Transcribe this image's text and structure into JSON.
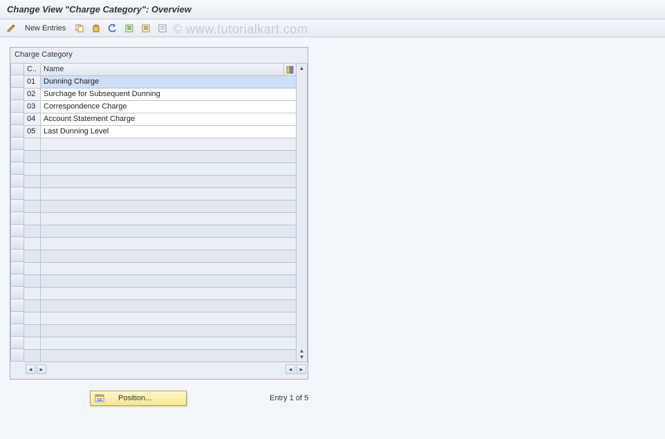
{
  "title": "Change View \"Charge Category\": Overview",
  "watermark": "© www.tutorialkart.com",
  "toolbar": {
    "new_entries_label": "New Entries"
  },
  "panel": {
    "title": "Charge Category",
    "columns": {
      "code": "C..",
      "name": "Name"
    },
    "rows": [
      {
        "code": "01",
        "name": "Dunning Charge",
        "selected": true
      },
      {
        "code": "02",
        "name": "Surchage for Subsequent Dunning"
      },
      {
        "code": "03",
        "name": "Correspondence Charge"
      },
      {
        "code": "04",
        "name": "Account Statement Charge"
      },
      {
        "code": "05",
        "name": "Last Dunning Level"
      }
    ],
    "empty_row_count": 18
  },
  "footer": {
    "position_label": "Position...",
    "entry_label": "Entry 1 of 5"
  }
}
